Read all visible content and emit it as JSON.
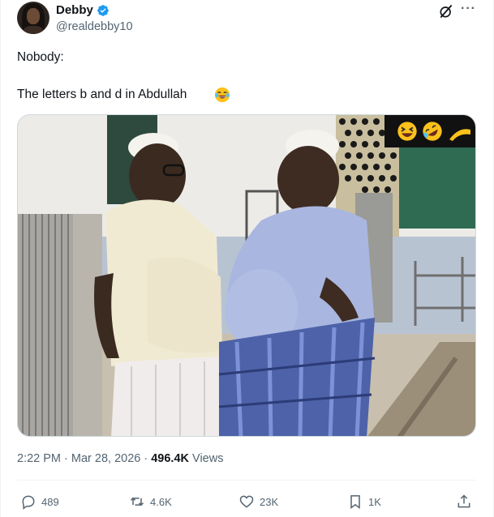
{
  "author": {
    "name": "Debby",
    "handle": "@realdebby10",
    "verified": true
  },
  "tweet": {
    "line1": "Nobody:",
    "line2": "The letters b and d in Abdullah",
    "line2_emoji": "face-with-tears-of-joy"
  },
  "media": {
    "emoji_overlay": [
      "laughing-face",
      "rolling-on-floor-laughing-face"
    ]
  },
  "meta": {
    "time": "2:22 PM",
    "separator1": " · ",
    "date": "Mar 28, 2026",
    "separator2": " · ",
    "views_count": "496.4K",
    "views_label": " Views"
  },
  "actions": {
    "replies": "489",
    "reposts": "4.6K",
    "likes": "23K",
    "bookmarks": "1K"
  },
  "colors": {
    "text": "#0f1419",
    "secondary": "#536471",
    "verified": "#1d9bf0",
    "border": "#eff3f4"
  }
}
